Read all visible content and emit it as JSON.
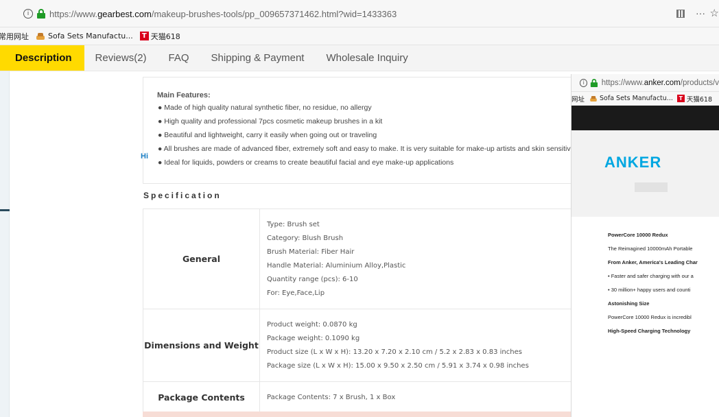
{
  "browser": {
    "url_prefix": "https://www.",
    "url_domain": "gearbest.com",
    "url_suffix": "/makeup-brushes-tools/pp_009657371462.html?wid=1433363",
    "info_glyph": "i",
    "more_glyph": "···",
    "star_glyph": "☆",
    "bookmarks": {
      "common": "常用网址",
      "sofa": "Sofa Sets Manufactu...",
      "tmall_badge": "T",
      "tmall": "天猫618"
    }
  },
  "tabs": [
    {
      "label": "Description",
      "active": true
    },
    {
      "label": "Reviews(2)"
    },
    {
      "label": "FAQ"
    },
    {
      "label": "Shipping & Payment"
    },
    {
      "label": "Wholesale Inquiry"
    }
  ],
  "features": {
    "title": "Main Features:",
    "items": [
      "● Made of high quality natural synthetic fiber, no residue, no allergy",
      "● High quality and professional 7pcs cosmetic makeup brushes in a kit",
      "● Beautiful and lightweight, carry it easily when going out or traveling",
      "● All brushes are made of advanced fiber, extremely soft and easy to make. It is very suitable for make-up artists and skin sensitive pe",
      "● Ideal for liquids, powders or creams to create beautiful facial and eye make-up applications"
    ]
  },
  "spec": {
    "title": "Specification",
    "rows": [
      {
        "label": "General",
        "values": [
          "Type: Brush set",
          "Category: Blush Brush",
          "Brush Material: Fiber Hair",
          "Handle Material: Aluminium Alloy,Plastic",
          "Quantity range (pcs): 6-10",
          "For: Eye,Face,Lip"
        ]
      },
      {
        "label": "Dimensions and Weight",
        "values": [
          "Product weight: 0.0870 kg",
          "Package weight: 0.1090 kg",
          "Product size (L x W x H): 13.20 x 7.20 x 2.10 cm / 5.2 x 2.83 x 0.83 inches",
          "Package size (L x W x H): 15.00 x 9.50 x 2.50 cm / 5.91 x 3.74 x 0.98 inches"
        ]
      },
      {
        "label": "Package Contents",
        "values": [
          "Package Contents: 7 x Brush, 1 x Box"
        ]
      }
    ]
  },
  "overlay": {
    "url_prefix": "https://www.",
    "url_domain": "anker.com",
    "url_suffix": "/products/v",
    "bookmarks": {
      "common": "网址",
      "sofa": "Sofa Sets Manufactu...",
      "tmall_badge": "T",
      "tmall": "天猫618"
    },
    "logo": "ANKER",
    "hi_text": "Hi",
    "lines": [
      {
        "text": "PowerCore 10000 Redux",
        "strong": true
      },
      {
        "text": "The Reimagined 10000mAh Portable",
        "strong": false
      },
      {
        "text": "From Anker, America's Leading Char",
        "strong": true
      },
      {
        "text": "• Faster and safer charging with our a",
        "strong": false
      },
      {
        "text": "• 30 million+ happy users and counti",
        "strong": false
      },
      {
        "text": "Astonishing Size",
        "strong": true
      },
      {
        "text": "PowerCore 10000 Redux is incredibl",
        "strong": false
      },
      {
        "text": "High-Speed Charging Technology",
        "strong": true
      }
    ]
  }
}
